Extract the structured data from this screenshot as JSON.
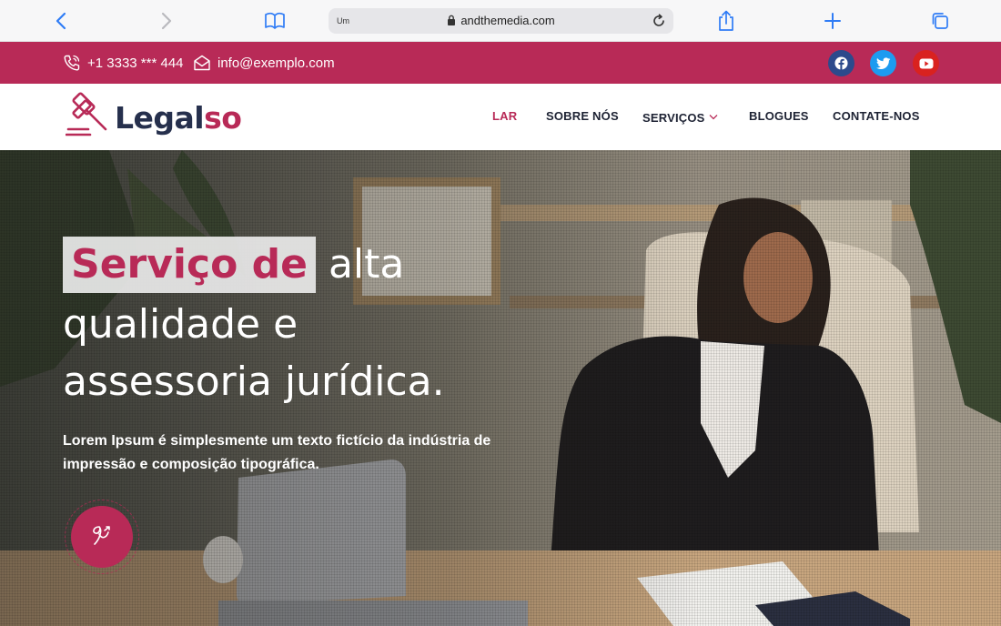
{
  "browser": {
    "url_small": "Um",
    "url": "andthemedia.com"
  },
  "topbar": {
    "phone": "+1 3333 *** 444",
    "email": "info@exemplo.com",
    "social": [
      "facebook-icon",
      "twitter-icon",
      "youtube-icon"
    ],
    "bg_color": "#b82a57"
  },
  "logo": {
    "part1": "Legal",
    "part2": "so"
  },
  "nav": {
    "items": [
      {
        "label": "LAR",
        "active": true
      },
      {
        "label": "SOBRE NÓS"
      },
      {
        "label": "SERVIÇOS",
        "has_dropdown": true
      },
      {
        "label": "BLOGUES"
      },
      {
        "label": "CONTATE-NOS"
      }
    ]
  },
  "hero": {
    "highlight": "Serviço de",
    "line1_rest": "alta",
    "line2": "qualidade e",
    "line3": "assessoria jurídica.",
    "subtitle": "Lorem Ipsum é simplesmente um texto fictício da indústria de impressão e composição tipográfica."
  },
  "colors": {
    "accent": "#b82a57",
    "dark": "#26304d"
  }
}
